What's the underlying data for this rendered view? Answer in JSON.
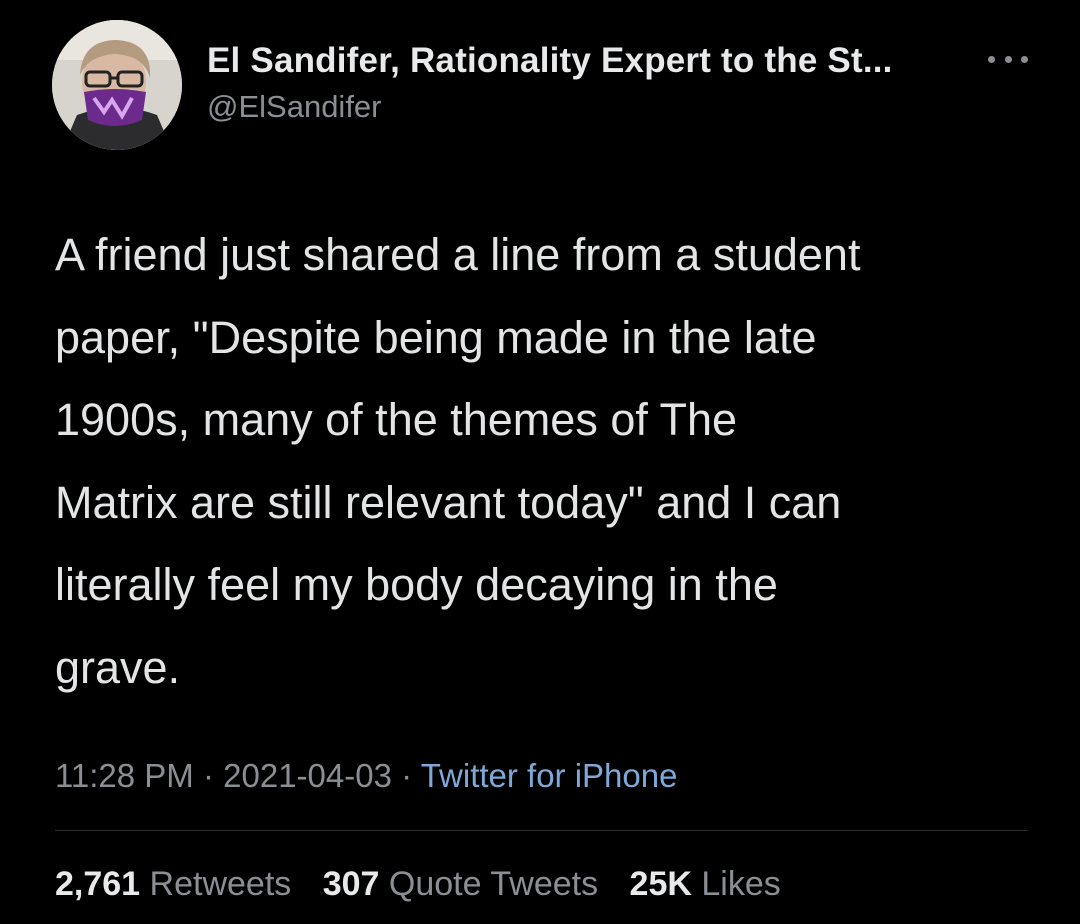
{
  "user": {
    "display_name": "El Sandifer, Rationality Expert to the St...",
    "handle": "@ElSandifer"
  },
  "tweet": {
    "text": "A friend just shared a line from a student\npaper, \"Despite being made in the late\n1900s, many of the themes of The\nMatrix are still relevant today\" and I can\nliterally feel my body decaying in the\ngrave."
  },
  "meta": {
    "time": "11:28 PM",
    "sep1": " · ",
    "date": "2021-04-03",
    "sep2": " · ",
    "source": "Twitter for iPhone"
  },
  "stats": {
    "retweets_count": "2,761",
    "retweets_label": "Retweets",
    "quotes_count": "307",
    "quotes_label": "Quote Tweets",
    "likes_count": "25K",
    "likes_label": "Likes"
  },
  "icons": {
    "more": "more-options-icon",
    "avatar": "avatar"
  },
  "colors": {
    "background": "#000000",
    "text": "#e7e9ea",
    "muted": "#8b8f94",
    "link": "#7ea8d8"
  }
}
